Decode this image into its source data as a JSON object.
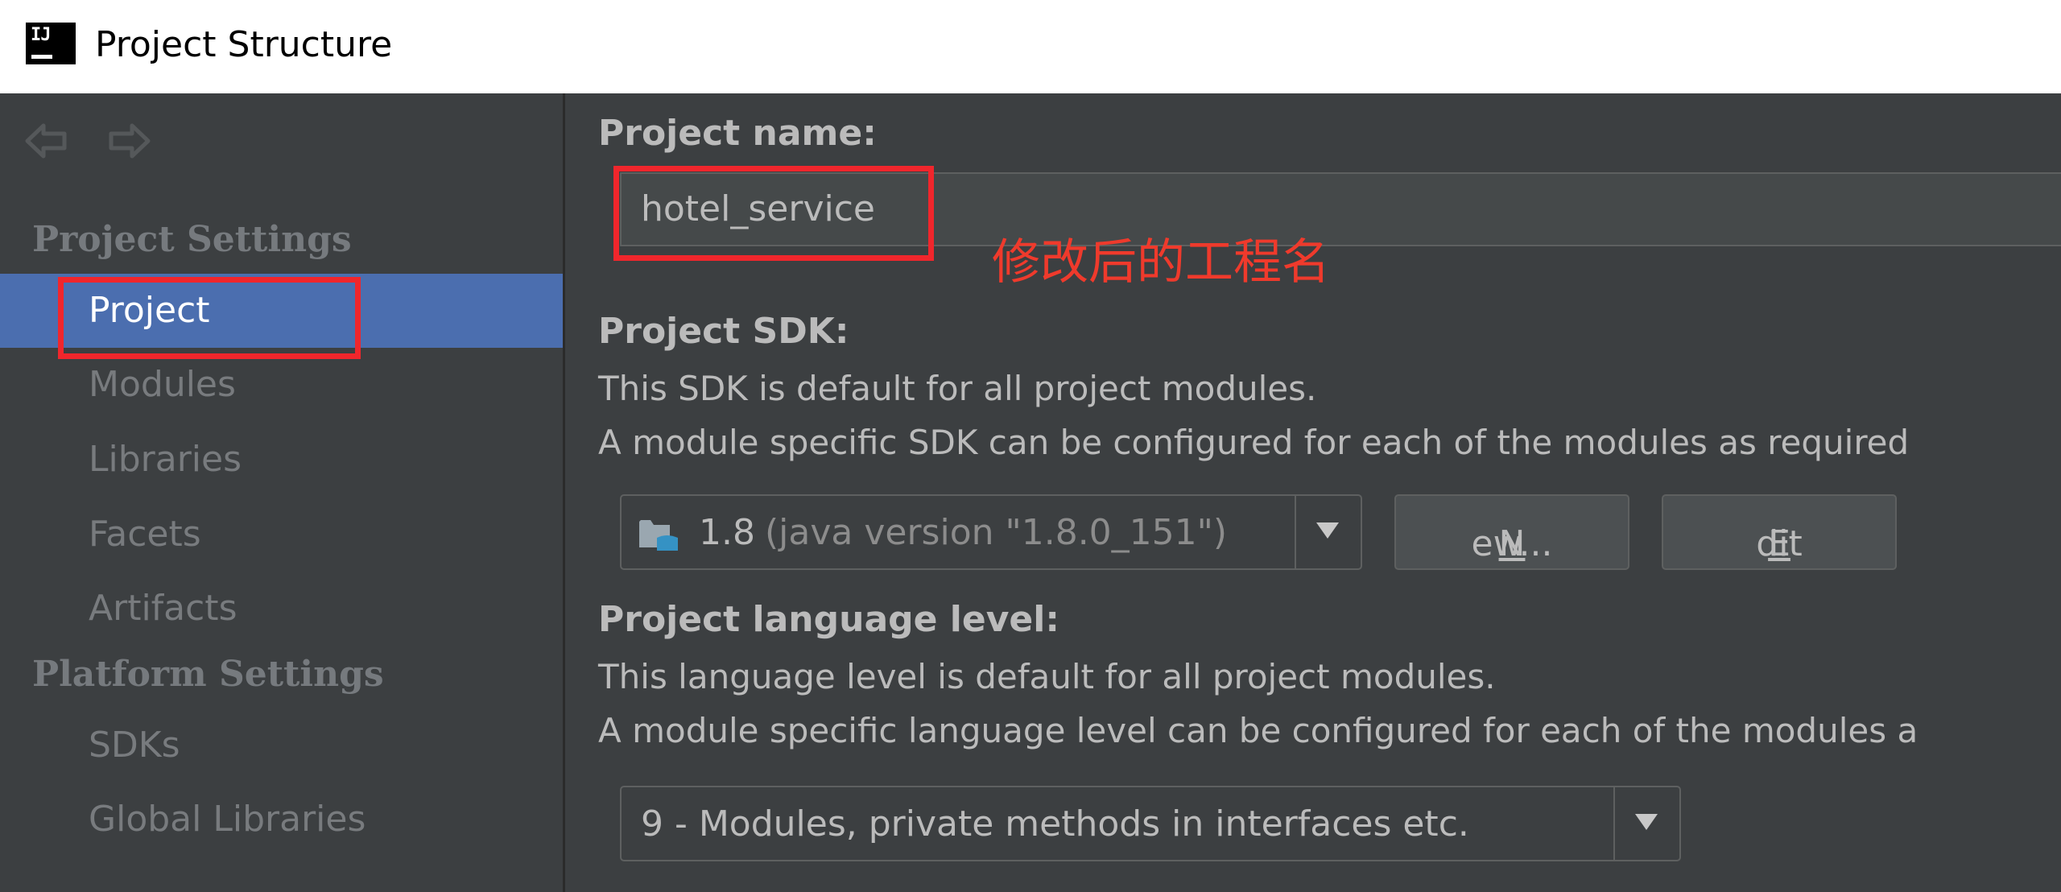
{
  "window": {
    "title": "Project Structure",
    "logo_text": "IJ"
  },
  "sidebar": {
    "project_settings_heading": "Project Settings",
    "project_items": [
      {
        "label": "Project",
        "selected": true
      },
      {
        "label": "Modules"
      },
      {
        "label": "Libraries"
      },
      {
        "label": "Facets"
      },
      {
        "label": "Artifacts"
      }
    ],
    "platform_settings_heading": "Platform Settings",
    "platform_items": [
      {
        "label": "SDKs"
      },
      {
        "label": "Global Libraries"
      }
    ]
  },
  "main": {
    "project_name_label": "Project name:",
    "project_name_value": "hotel_service",
    "annotation": "修改后的工程名",
    "sdk_label": "Project SDK:",
    "sdk_desc_1": "This SDK is default for all project modules.",
    "sdk_desc_2": "A module specific SDK can be configured for each of the modules as required",
    "sdk_combo": {
      "version": "1.8",
      "detail": "(java version \"1.8.0_151\")"
    },
    "new_button": {
      "mnemonic": "N",
      "rest": "ew..."
    },
    "edit_button": {
      "mnemonic": "E",
      "rest": "dit"
    },
    "lang_label": "Project language level:",
    "lang_desc_1": "This language level is default for all project modules.",
    "lang_desc_2": "A module specific language level can be configured for each of the modules a",
    "lang_combo_value": "9 - Modules, private methods in interfaces etc."
  },
  "colors": {
    "accent_selection": "#4b6eaf",
    "annotation_red": "#f0262c",
    "background": "#3c3f41"
  },
  "icons": [
    "back-arrow-icon",
    "forward-arrow-icon",
    "folder-icon",
    "chevron-down-icon"
  ]
}
